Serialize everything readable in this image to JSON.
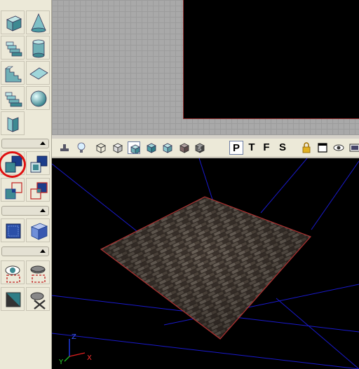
{
  "viewport_toolbar": {
    "view_modes": [
      "P",
      "T",
      "F",
      "S"
    ]
  },
  "left_toolbar": {
    "sections": 4
  },
  "axis_gizmo": {
    "x_label": "X",
    "y_label": "Y",
    "z_label": "Z"
  },
  "colors": {
    "highlight": "#e01010",
    "axis_x": "#e02020",
    "axis_y": "#20c020",
    "axis_z": "#2040ff",
    "grid_3d": "#1a1acc",
    "brush_outline": "#b03030"
  }
}
